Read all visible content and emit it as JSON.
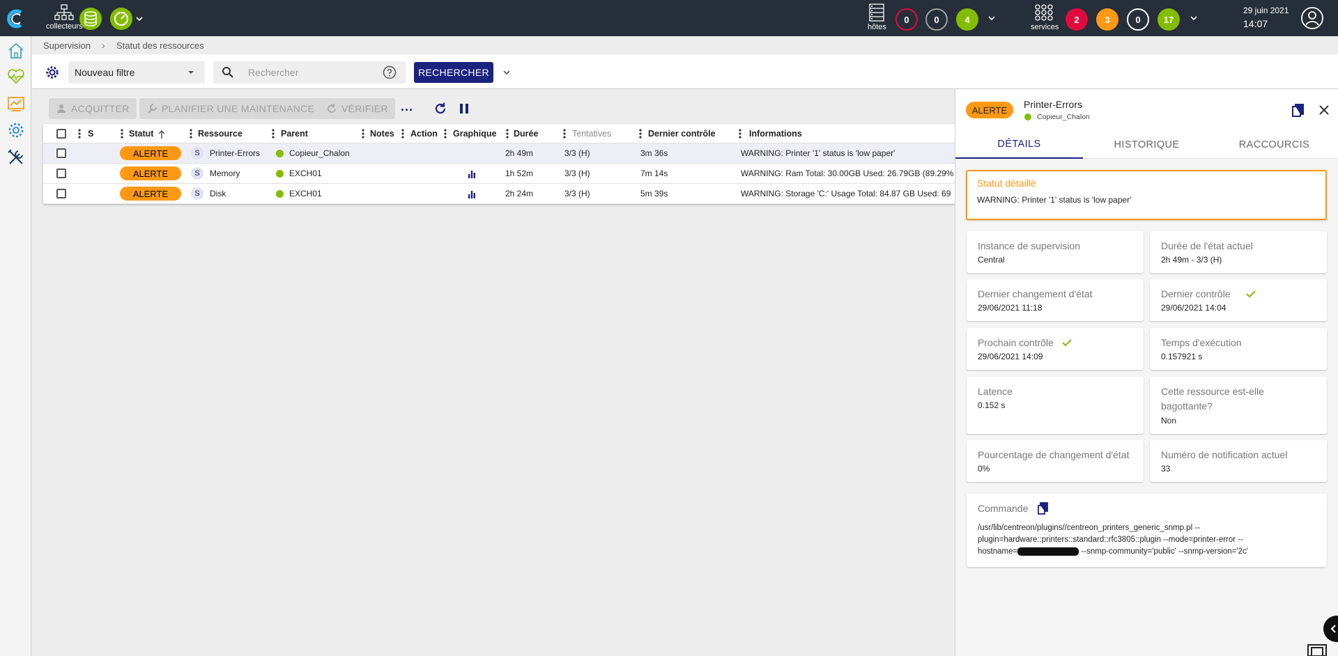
{
  "topbar": {
    "collectors_label": "collecteurs",
    "hosts_label": "hôtes",
    "services_label": "services",
    "hosts_counts": [
      "0",
      "0",
      "4"
    ],
    "services_counts": [
      "2",
      "3",
      "0",
      "17"
    ],
    "date": "29 juin 2021",
    "time": "14:07",
    "colors": {
      "down": "#e00b3d",
      "unreachable": "#a0a0a0",
      "up": "#84bd00",
      "critical": "#e00b3d",
      "warning": "#ff9913",
      "unknown": "#ffffff",
      "ok": "#84bd00"
    }
  },
  "breadcrumb": {
    "items": [
      "Supervision",
      "Statut des ressources"
    ]
  },
  "filterbar": {
    "filter_value": "Nouveau filtre",
    "search_placeholder": "Rechercher",
    "search_button": "RECHERCHER"
  },
  "toolbar": {
    "acknowledge": "ACQUITTER",
    "downtime": "PLANIFIER UNE MAINTENANCE",
    "check": "VÉRIFIER",
    "more": "..."
  },
  "table": {
    "headers": {
      "s": "S",
      "status": "Statut",
      "resource": "Ressource",
      "parent": "Parent",
      "notes": "Notes",
      "action": "Action",
      "graph": "Graphique",
      "duration": "Durée",
      "tries": "Tentatives",
      "last_check": "Dernier contrôle",
      "information": "Informations"
    },
    "rows": [
      {
        "status": "ALERTE",
        "type": "S",
        "resource": "Printer-Errors",
        "parent": "Copieur_Chalon",
        "graph": false,
        "duration": "2h 49m",
        "tries": "3/3 (H)",
        "last_check": "3m 36s",
        "information": "WARNING: Printer '1' status is 'low paper'"
      },
      {
        "status": "ALERTE",
        "type": "S",
        "resource": "Memory",
        "parent": "EXCH01",
        "graph": true,
        "duration": "1h 52m",
        "tries": "3/3 (H)",
        "last_check": "7m 14s",
        "information": "WARNING: Ram Total: 30.00GB Used: 26.79GB (89.29%"
      },
      {
        "status": "ALERTE",
        "type": "S",
        "resource": "Disk",
        "parent": "EXCH01",
        "graph": true,
        "duration": "2h 24m",
        "tries": "3/3 (H)",
        "last_check": "5m 39s",
        "information": "WARNING: Storage 'C:' Usage Total: 84.87 GB Used: 69"
      }
    ]
  },
  "panel": {
    "status": "ALERTE",
    "resource": "Printer-Errors",
    "parent": "Copieur_Chalon",
    "tabs": [
      "DÉTAILS",
      "HISTORIQUE",
      "RACCOURCIS"
    ],
    "detailed_status_label": "Statut détaillé",
    "detailed_status_value": "WARNING: Printer '1' status is 'low paper'",
    "details": [
      {
        "label": "Instance de supervision",
        "value": "Central"
      },
      {
        "label": "Durée de l'état actuel",
        "value": "2h 49m - 3/3 (H)"
      },
      {
        "label": "Dernier changement d'état",
        "value": "29/06/2021 11:18"
      },
      {
        "label": "Dernier contrôle",
        "value": "29/06/2021 14:04"
      },
      {
        "label": "Prochain contrôle",
        "value": "29/06/2021 14:09"
      },
      {
        "label": "Temps d'exécution",
        "value": "0.157921 s"
      },
      {
        "label": "Latence",
        "value": "0.152 s"
      },
      {
        "label": "Cette ressource est-elle bagottante?",
        "value": "Non"
      },
      {
        "label": "Pourcentage de changement d'état",
        "value": "0%"
      },
      {
        "label": "Numéro de notification actuel",
        "value": "33"
      }
    ],
    "command_label": "Commande",
    "command_line1": "/usr/lib/centreon/plugins//centreon_printers_generic_snmp.pl --",
    "command_line2": "plugin=hardware::printers::standard::rfc3805::plugin --mode=printer-error --",
    "command_line3_prefix": "hostname=",
    "command_line3_suffix": " --snmp-community='public' --snmp-version='2c'"
  }
}
